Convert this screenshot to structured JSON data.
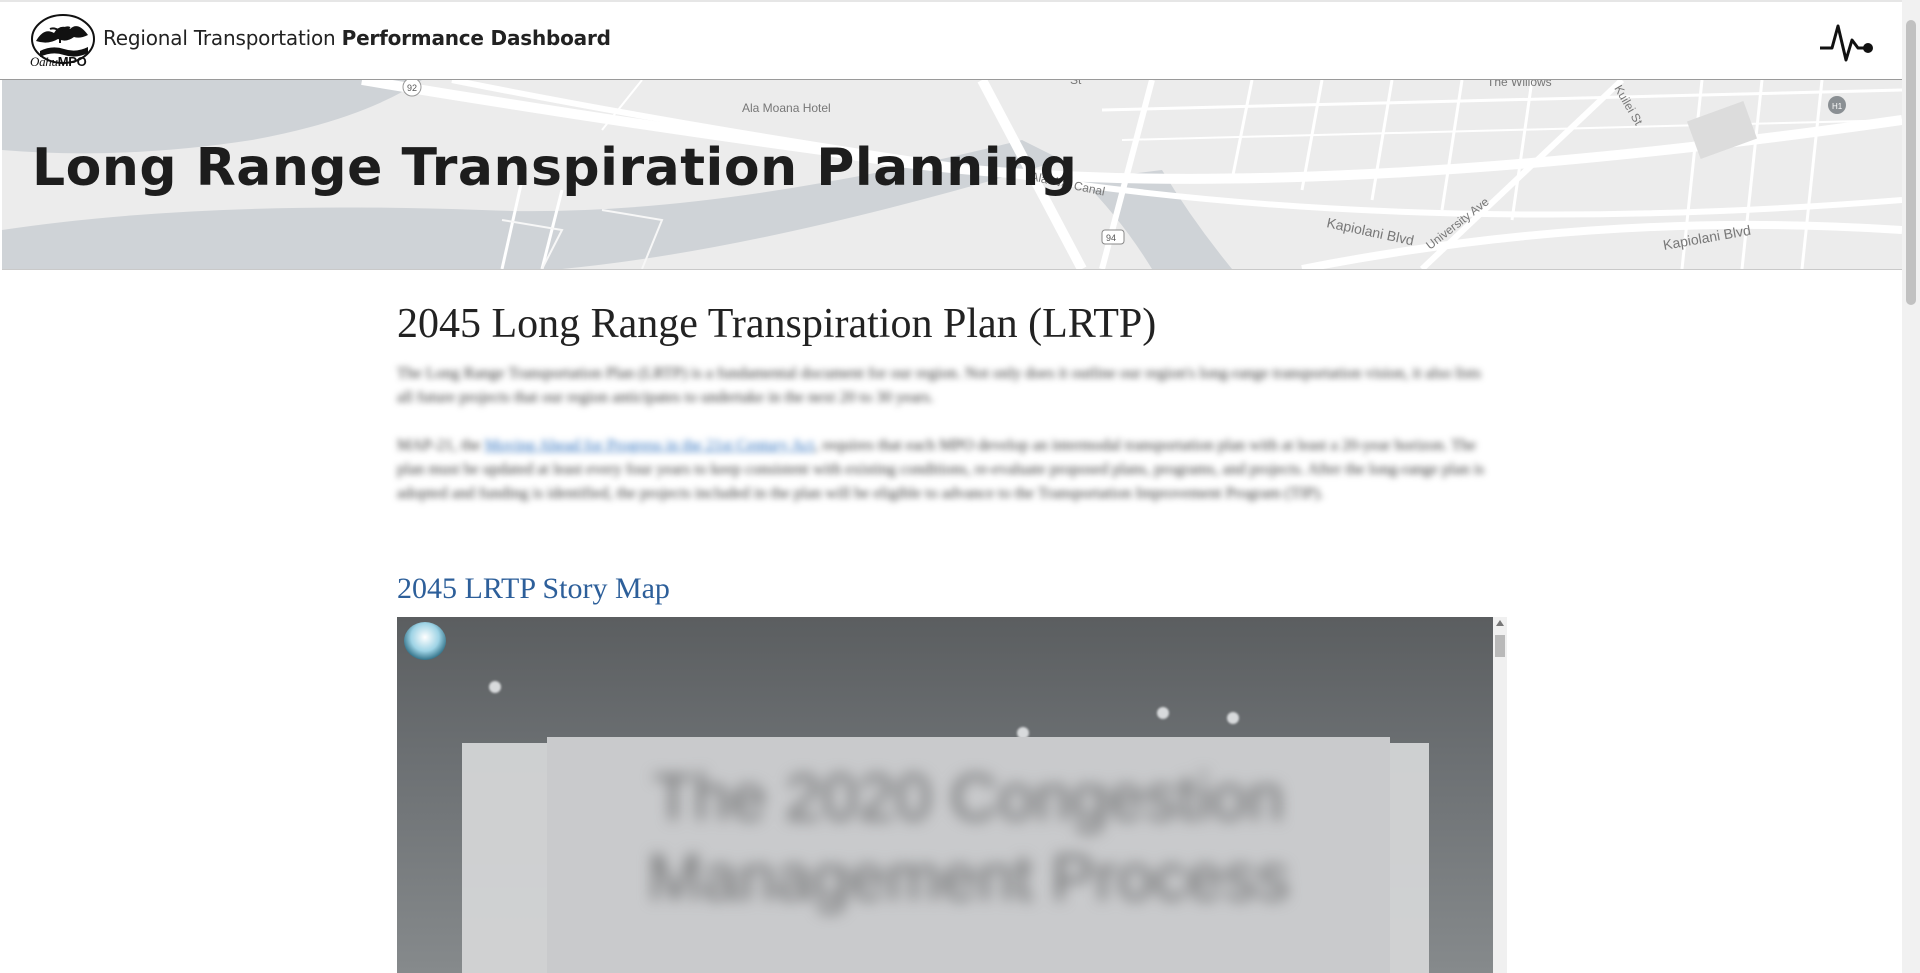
{
  "header": {
    "logo_text_italic": "Oahu",
    "logo_text_bold": "MPO",
    "title_regular": "Regional Transportation ",
    "title_bold": "Performance Dashboard",
    "pulse_icon": "heartbeat-icon"
  },
  "banner": {
    "title": "Long Range Transpiration Planning",
    "map_labels": {
      "hotel": "Ala Moana Hotel",
      "canal": "Ala Wai Canal",
      "willows": "The Willows",
      "kapiolani1": "Kapiolani Blvd",
      "kapiolani2": "Kapiolani Blvd",
      "university": "University Ave",
      "street": "St",
      "kuilei": "Kuilei St",
      "route92": "92",
      "route94": "94",
      "h1": "H1"
    }
  },
  "main": {
    "heading": "2045 Long Range Transpiration Plan (LRTP)",
    "para1": "The Long Range Transportation Plan (LRTP) is a fundamental document for our region. Not only does it outline our region's long-range transportation vision, it also lists all future projects that our region anticipates to undertake in the next 20 to 30 years.",
    "para2_before": "MAP-21, the ",
    "para2_link": "Moving Ahead for Progress in the 21st Century Act",
    "para2_after": ", requires that each MPO develop an intermodal transportation plan with at least a 20-year horizon. The plan must be updated at least every four years to keep consistent with existing conditions, re-evaluate proposed plans, programs, and projects. After the long-range plan is adopted and funding is identified, the projects included in the plan will be eligible to advance to the Transportation Improvement Program (TIP).",
    "story_map_link": "2045 LRTP Story Map",
    "embed_title": "The 2020 Congestion Management Process"
  }
}
